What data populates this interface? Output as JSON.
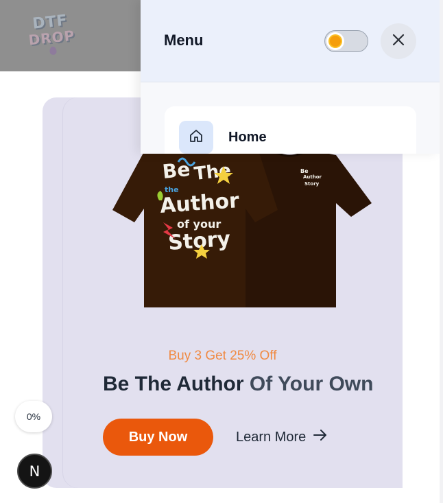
{
  "brand": {
    "logo_line1": "DTF",
    "logo_line2": "DROP"
  },
  "menu": {
    "title": "Menu",
    "items": [
      {
        "label": "Home",
        "icon": "home-icon"
      }
    ],
    "theme_toggle": {
      "state": "light",
      "icon": "sun-icon"
    },
    "close_icon": "close-icon"
  },
  "hero": {
    "offer": "Buy 3 Get 25% Off",
    "headline_dark": "Be The Author",
    "headline_muted": "Of Your Own",
    "buy_label": "Buy Now",
    "learn_label": "Learn More",
    "print_text": [
      "Be",
      "The",
      "the",
      "Author",
      "of your",
      "Story"
    ]
  },
  "widgets": {
    "progress": "0%",
    "avatar_letter": "N"
  },
  "colors": {
    "accent": "#ea580c",
    "offer": "#f08a43",
    "hero_bg": "#e2e0ef",
    "menu_header_bg": "#ebf0fb"
  }
}
